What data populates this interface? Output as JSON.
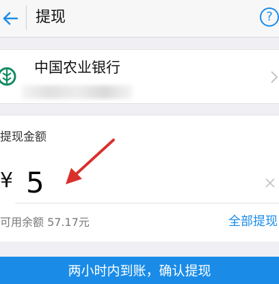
{
  "header": {
    "back_icon": "arrow-left-icon",
    "title": "提现",
    "help_label": "?",
    "accent_color": "#1a8ce8"
  },
  "bank": {
    "logo_icon": "bank-logo-icon",
    "name": "中国农业银行",
    "account_masked": true,
    "chevron_icon": "chevron-right-icon"
  },
  "withdraw": {
    "label": "提现金额",
    "currency": "¥",
    "amount": "5",
    "clear_icon": "close-icon",
    "balance_text": "可用余额 57.17元",
    "withdraw_all_label": "全部提现"
  },
  "footer": {
    "confirm_label": "两小时内到账，确认提现"
  }
}
